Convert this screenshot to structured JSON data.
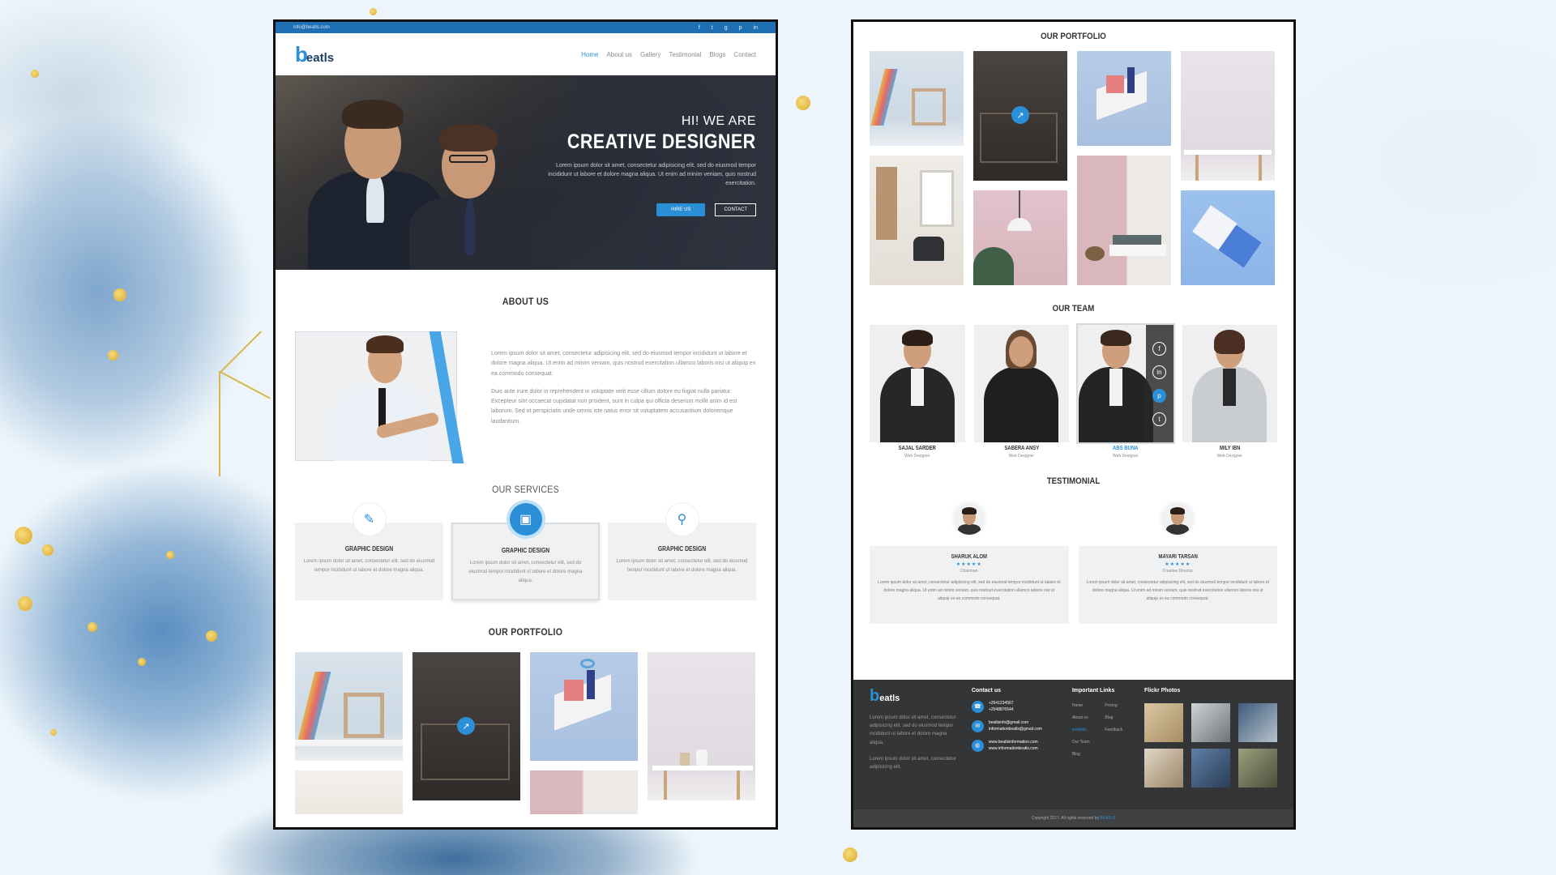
{
  "left_mockup": {
    "topbar": {
      "email": "info@beatls.com",
      "social_icons": [
        "facebook-icon",
        "twitter-icon",
        "google-plus-icon",
        "pinterest-icon",
        "linkedin-icon"
      ]
    },
    "logo": {
      "mark": "b",
      "text": "eatls"
    },
    "nav": [
      "Home",
      "About us",
      "Gallery",
      "Testimonial",
      "Blogs",
      "Contact"
    ],
    "hero": {
      "greeting": "HI! WE ARE",
      "title": "CREATIVE DESIGNER",
      "description": "Lorem ipsum dolor sit amet, consectetur adipisicing elit, sed do eiusmod tempor incididunt ut labore et dolore magna aliqua. Ut enim ad minim veniam, quis nostrud exercitation.",
      "primary_button": "HIRE US",
      "secondary_button": "CONTACT"
    },
    "about": {
      "title": "ABOUT US",
      "paragraph1": "Lorem ipsum dolor sit amet, consectetur adipisicing elit, sed do eiusmod tempor incididunt ut labore et dolore magna aliqua. Ut enim ad minim veniam, quis nostrud exercitation ullamco laboris nisi ut aliquip ex ea commodo consequat.",
      "paragraph2": "Duis aute irure dolor in reprehenderit in voluptate velit esse cillum dolore eu fugiat nulla pariatur. Excepteur sint occaecat cupidatat non proident, sunt in culpa qui officia deserunt mollit anim id est laborum. Sed ut perspiciatis unde omnis iste natus error sit voluptatem accusantium doloremque laudantium."
    },
    "services": {
      "title": "OUR SERVICES",
      "items": [
        {
          "icon": "pen-tool-icon",
          "name": "GRAPHIC DESIGN",
          "description": "Lorem ipsum dolor sit amet, consectetur elit, sed do eiusmod tempor incididunt ut labore et dolore magna aliqua."
        },
        {
          "icon": "monitor-icon",
          "name": "GRAPHIC DESIGN",
          "description": "Lorem ipsum dolor sit amet, consectetur elit, sed do eiusmod tempor incididunt ut labore et dolore magna aliqua."
        },
        {
          "icon": "search-icon",
          "name": "GRAPHIC DESIGN",
          "description": "Lorem ipsum dolor sit amet, consectetur elit, sed do eiusmod tempor incididunt ut labore et dolore magna aliqua."
        }
      ]
    },
    "portfolio_title": "OUR PORTFOLIO"
  },
  "right_mockup": {
    "portfolio_title": "OUR PORTFOLIO",
    "team": {
      "title": "OUR TEAM",
      "members": [
        {
          "name": "SAJAL SARDER",
          "role": "Web Designer"
        },
        {
          "name": "SABERA ANSY",
          "role": "Web Designer"
        },
        {
          "name": "ABS BUNA",
          "role": "Web Designer"
        },
        {
          "name": "MILY IBN",
          "role": "Web Designer"
        }
      ],
      "hover_social_icons": [
        "facebook-icon",
        "linkedin-icon",
        "pinterest-icon",
        "twitter-icon"
      ]
    },
    "testimonial": {
      "title": "TESTIMONIAL",
      "items": [
        {
          "name": "SHARUK ALOM",
          "stars": "★★★★★",
          "role": "Chairman",
          "text": "Lorem ipsum dolor sit amet, consectetur adipisicing elit, sed do eiusmod tempor incididunt ut labore et dolore magna aliqua. Ut enim ad minim veniam, quis nostrud exercitation ullamco laboris nisi ut aliquip ex ea commodo consequat."
        },
        {
          "name": "MAYARI TARSAN",
          "stars": "★★★★★",
          "role": "Creative Director",
          "text": "Lorem ipsum dolor sit amet, consectetur adipisicing elit, sed do eiusmod tempor incididunt ut labore et dolore magna aliqua. Ut enim ad minim veniam, quis nostrud exercitation ullamco laboris nisi ut aliquip ex ea commodo consequat."
        }
      ]
    },
    "footer": {
      "logo": {
        "mark": "b",
        "text": "eatls"
      },
      "about_p1": "Lorem ipsum dolor sit amet, consectetur adipisicing elit, sed do eiusmod tempor incididunt ut labore et dolore magna aliqua.",
      "about_p2": "Lorem ipsum dolor sit amet, consectetur adipisicing elit.",
      "contact_title": "Contact us",
      "contacts": [
        {
          "icon": "phone-icon",
          "line1": "+2541234567",
          "line2": "+2548876544"
        },
        {
          "icon": "mail-icon",
          "line1": "beatlsinfo@gmail.com",
          "line2": "informationbeatls@gmail.com"
        },
        {
          "icon": "globe-icon",
          "line1": "www.beatlsinformation.com",
          "line2": "www.informationbeatls.com"
        }
      ],
      "links_title": "Important Links",
      "links": [
        "Home",
        "Pricing",
        "About us",
        "Blog",
        "portfolio",
        "Feedback",
        "Our Team",
        "",
        "Blog",
        ""
      ],
      "photos_title": "Flickr Photos",
      "copyright_prefix": "Copyright 2017. All rights reserved by",
      "copyright_brand": "BEATLS"
    }
  },
  "colors": {
    "accent": "#2a8fd6",
    "footer_bg": "#333536"
  }
}
